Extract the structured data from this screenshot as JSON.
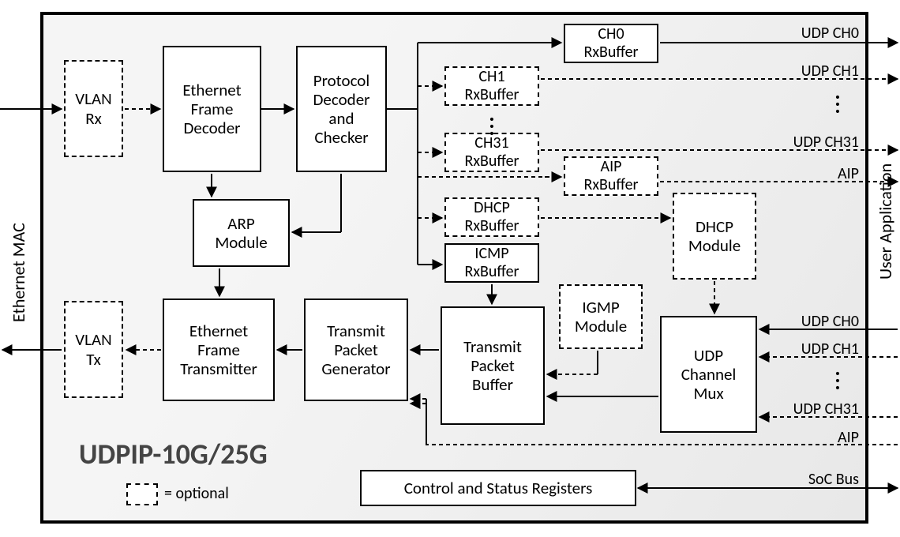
{
  "diagram_title": "UDPIP-10G/25G",
  "legend_label": "= optional",
  "left_side_label": "Ethernet MAC",
  "right_side_label": "User Application",
  "blocks": {
    "vlan_rx": "VLAN\nRx",
    "eth_decoder": "Ethernet\nFrame\nDecoder",
    "proto_checker": "Protocol\nDecoder\nand\nChecker",
    "ch0_rxbuf": "CH0\nRxBuffer",
    "ch1_rxbuf": "CH1\nRxBuffer",
    "ch31_rxbuf": "CH31\nRxBuffer",
    "aip_rxbuf": "AIP\nRxBuffer",
    "dhcp_rxbuf": "DHCP\nRxBuffer",
    "dhcp_module": "DHCP\nModule",
    "icmp_rxbuf": "ICMP\nRxBuffer",
    "igmp_module": "IGMP\nModule",
    "arp_module": "ARP\nModule",
    "vlan_tx": "VLAN\nTx",
    "eth_tx": "Ethernet\nFrame\nTransmitter",
    "tx_pkt_gen": "Transmit\nPacket\nGenerator",
    "tx_pkt_buf": "Transmit\nPacket\nBuffer",
    "udp_mux": "UDP\nChannel\nMux",
    "csr": "Control and Status Registers"
  },
  "right_labels": {
    "udp_ch0_top": "UDP CH0",
    "udp_ch1_top": "UDP CH1",
    "udp_ch31_top": "UDP CH31",
    "aip_top": "AIP",
    "udp_ch0_bot": "UDP CH0",
    "udp_ch1_bot": "UDP CH1",
    "udp_ch31_bot": "UDP CH31",
    "aip_bot": "AIP",
    "soc_bus": "SoC Bus"
  }
}
